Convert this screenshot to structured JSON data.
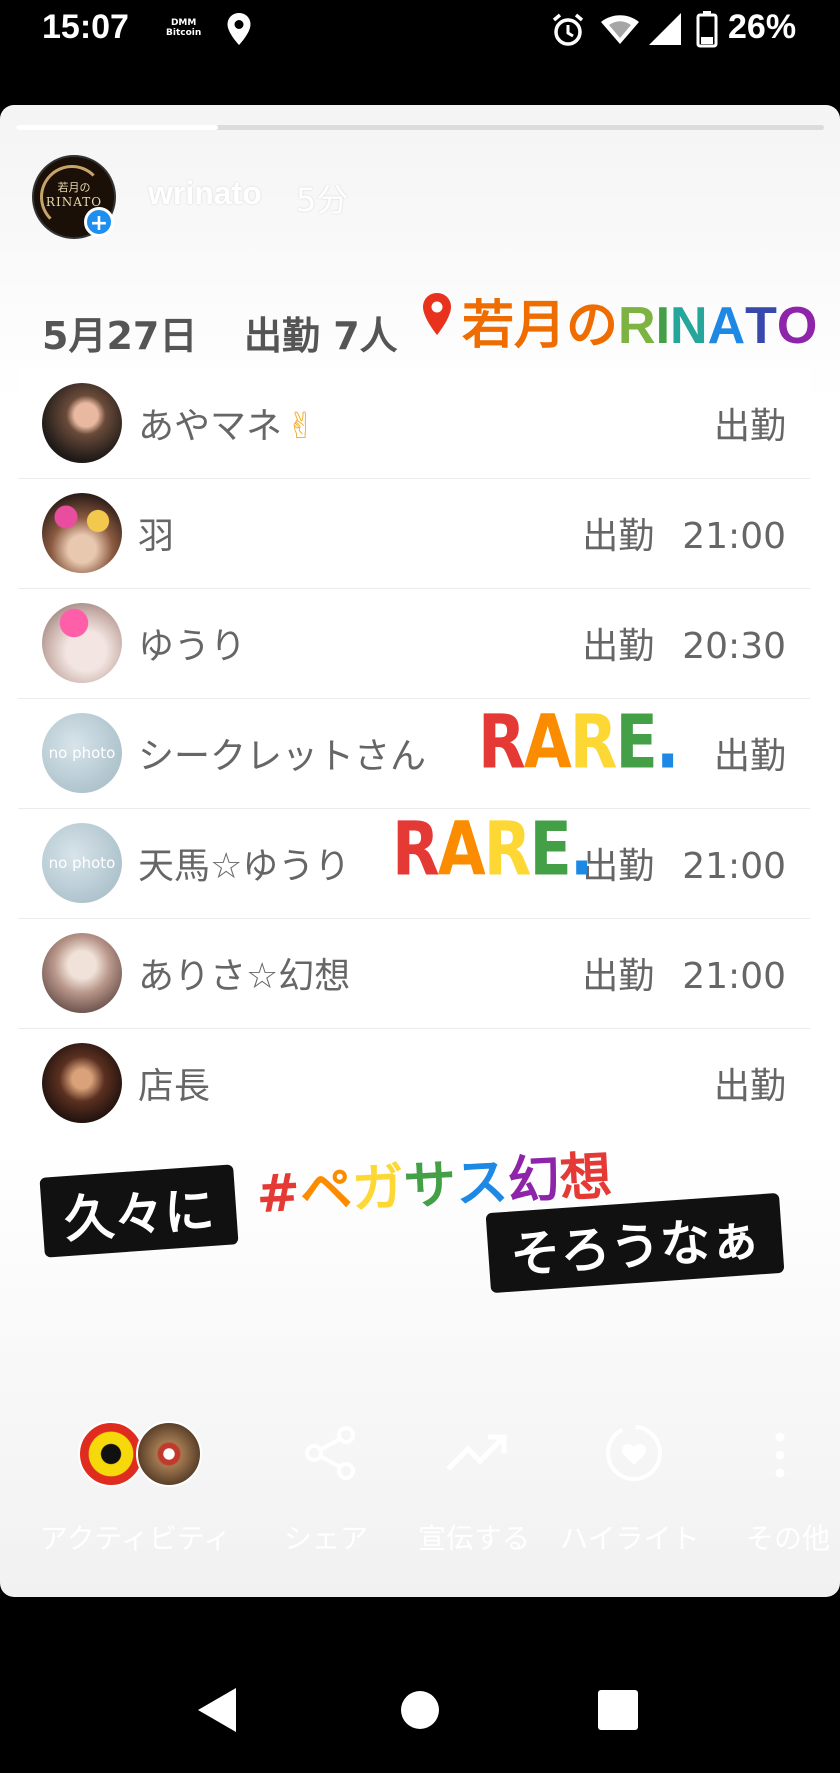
{
  "status_bar": {
    "time": "15:07",
    "dmm_line1": "DMM",
    "dmm_line2": "Bitcoin",
    "battery": "26%"
  },
  "story": {
    "progress": 0.25,
    "avatar_text_line1": "若月の",
    "avatar_text_line2": "RINATO",
    "username": "wrinato",
    "time_ago": "5分"
  },
  "header": {
    "date": "5月27日",
    "count": "出勤 7人",
    "place_part1": "若月の",
    "place_part2": "RINATO"
  },
  "list": [
    {
      "name": "あやマネ",
      "emoji": "✌",
      "status": "出勤",
      "time": ""
    },
    {
      "name": "羽",
      "status": "出勤",
      "time": "21:00"
    },
    {
      "name": "ゆうり",
      "status": "出勤",
      "time": "20:30"
    },
    {
      "name": "シークレットさん",
      "status": "出勤",
      "time": "",
      "nophoto": "no photo"
    },
    {
      "name": "天馬☆ゆうり",
      "status": "出勤",
      "time": "21:00",
      "nophoto": "no photo"
    },
    {
      "name": "ありさ☆幻想",
      "status": "出勤",
      "time": "21:00"
    },
    {
      "name": "店長",
      "status": "出勤",
      "time": ""
    }
  ],
  "stickers": {
    "rare": "RARE.",
    "hisashiburi": "久々に",
    "hashtag": "#ペガサス幻想",
    "soroune": "そろうなぁ"
  },
  "bottom_bar": {
    "activity": "アクティビティ",
    "share": "シェア",
    "promote": "宣伝する",
    "highlight": "ハイライト",
    "more": "その他"
  },
  "colors": {
    "accent_blue": "#1d8ff0",
    "text_gray": "#666666",
    "rainbow": [
      "#e53935",
      "#fb8c00",
      "#fdd835",
      "#43a047",
      "#1e88e5",
      "#8e24aa"
    ]
  }
}
